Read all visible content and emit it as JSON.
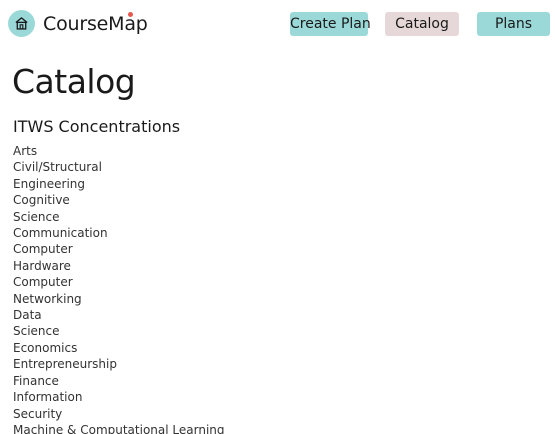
{
  "brand": {
    "name_prefix": "CourseM",
    "name_accent": "a",
    "name_suffix": "p",
    "logo_icon": "house-icon",
    "accent_color": "#9bd9d8",
    "dot_color": "#e5584f"
  },
  "nav": {
    "create_plan": "Create Plan",
    "catalog": "Catalog",
    "plans": "Plans",
    "active": "catalog",
    "active_color": "#e6d8d8"
  },
  "page": {
    "title": "Catalog"
  },
  "catalog": {
    "section_title": "ITWS Concentrations",
    "items": [
      "Arts",
      "Civil/Structural",
      "Engineering",
      "Cognitive",
      "Science",
      "Communication",
      "Computer",
      "Hardware",
      "Computer",
      "Networking",
      "Data",
      "Science",
      "Economics",
      "Entrepreneurship",
      "Finance",
      "Information",
      "Security",
      "Machine & Computational Learning"
    ]
  }
}
